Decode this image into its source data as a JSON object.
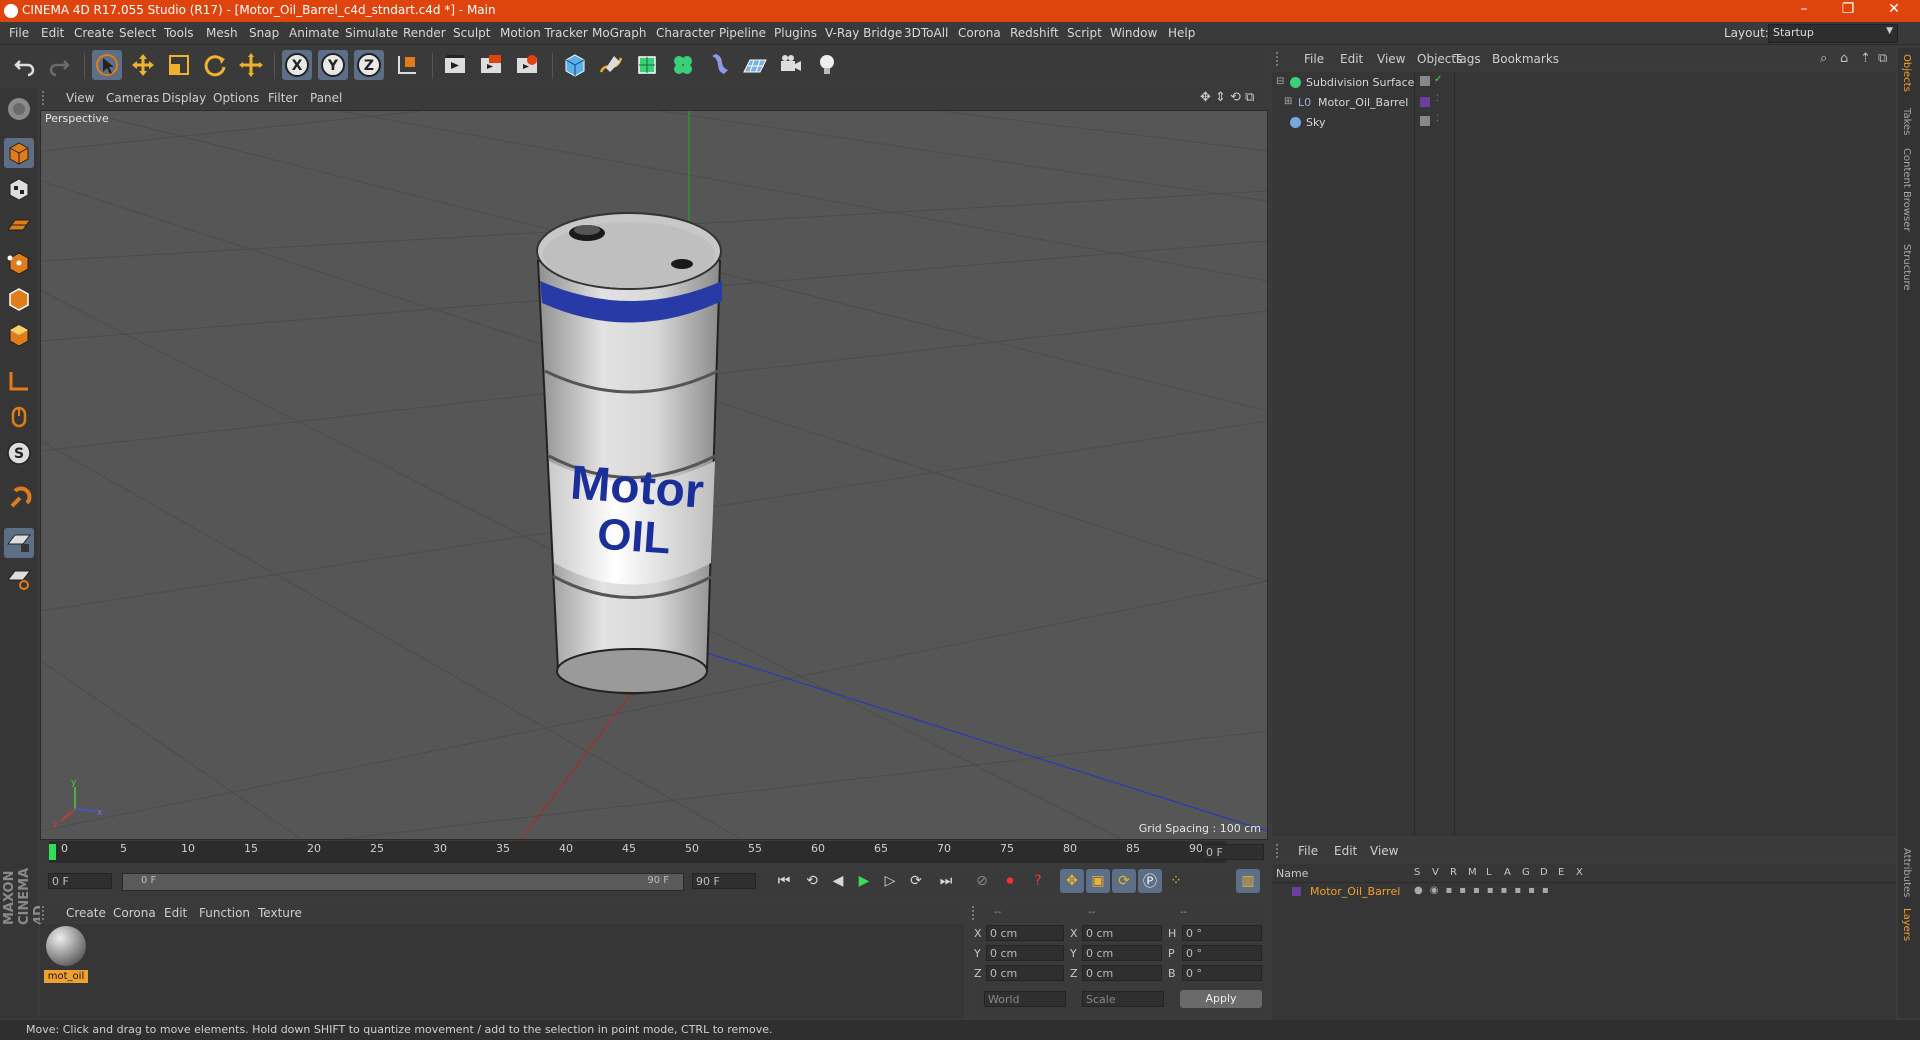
{
  "window": {
    "title": "CINEMA 4D R17.055 Studio (R17) - [Motor_Oil_Barrel_c4d_stndart.c4d *] - Main",
    "controls": [
      "–",
      "❐",
      "✕"
    ]
  },
  "menubar": {
    "items": [
      "File",
      "Edit",
      "Create",
      "Select",
      "Tools",
      "Mesh",
      "Snap",
      "Animate",
      "Simulate",
      "Render",
      "Sculpt",
      "Motion Tracker",
      "MoGraph",
      "Character",
      "Pipeline",
      "Plugins",
      "V-Ray Bridge",
      "3DToAll",
      "Corona",
      "Redshift",
      "Script",
      "Window",
      "Help"
    ],
    "layout_label": "Layout:",
    "layout_value": "Startup"
  },
  "toolbar": {
    "icons": [
      "undo-icon",
      "redo-icon",
      "live-select-icon",
      "move-icon",
      "scale-icon",
      "rotate-icon",
      "recent-tool-icon",
      "x-axis-icon",
      "y-axis-icon",
      "z-axis-icon",
      "coordinate-system-icon",
      "render-view-icon",
      "render-picture-viewer-icon",
      "render-settings-icon",
      "cube-icon",
      "pen-icon",
      "subdivision-icon",
      "cloner-icon",
      "deformer-icon",
      "floor-icon",
      "camera-icon",
      "light-icon"
    ],
    "axis_labels": {
      "x": "X",
      "y": "Y",
      "z": "Z"
    }
  },
  "left_tools": [
    "make-editable-icon",
    "model-mode-icon",
    "texture-mode-icon",
    "workplane-mode-icon",
    "points-mode-icon",
    "edges-mode-icon",
    "polygons-mode-icon",
    "axis-mode-icon",
    "tweak-mode-icon",
    "solo-mode-icon",
    "snap-icon",
    "workplane-lock-icon",
    "grid-icon"
  ],
  "maxon_logo": "MAXON CINEMA 4D",
  "viewport": {
    "menu": [
      "View",
      "Cameras",
      "Display",
      "Options",
      "Filter",
      "Panel"
    ],
    "label": "Perspective",
    "grid_spacing": "Grid Spacing : 100 cm",
    "barrel_text_line1": "Motor",
    "barrel_text_line2": "OIL",
    "axis_labels": {
      "y": "y",
      "x": "x",
      "z": "z"
    }
  },
  "timeline": {
    "ticks": [
      "0",
      "5",
      "10",
      "15",
      "20",
      "25",
      "30",
      "35",
      "40",
      "45",
      "50",
      "55",
      "60",
      "65",
      "70",
      "75",
      "80",
      "85",
      "90"
    ],
    "current_frame": "0 F",
    "start_field": "0 F",
    "range_start": "0 F",
    "range_end": "90 F",
    "end_field": "90 F"
  },
  "material_manager": {
    "menu": [
      "Create",
      "Corona",
      "Edit",
      "Function",
      "Texture"
    ],
    "material_name": "mot_oil"
  },
  "coordinates": {
    "headers": [
      "--",
      "--",
      "--"
    ],
    "rows": [
      {
        "a": "X",
        "a_val": "0 cm",
        "b": "X",
        "b_val": "0 cm",
        "c": "H",
        "c_val": "0 °"
      },
      {
        "a": "Y",
        "a_val": "0 cm",
        "b": "Y",
        "b_val": "0 cm",
        "c": "P",
        "c_val": "0 °"
      },
      {
        "a": "Z",
        "a_val": "0 cm",
        "b": "Z",
        "b_val": "0 cm",
        "c": "B",
        "c_val": "0 °"
      }
    ],
    "world": "World",
    "scale": "Scale",
    "apply": "Apply"
  },
  "object_manager": {
    "menu": [
      "File",
      "Edit",
      "View",
      "Objects",
      "Tags",
      "Bookmarks"
    ],
    "objects": [
      {
        "name": "Subdivision Surface",
        "icon": "subdivision-icon"
      },
      {
        "name": "Motor_Oil_Barrel",
        "icon": "null-object-icon"
      },
      {
        "name": "Sky",
        "icon": "sky-icon"
      }
    ]
  },
  "layer_manager": {
    "menu": [
      "File",
      "Edit",
      "View"
    ],
    "columns": [
      "Name",
      "S",
      "V",
      "R",
      "M",
      "L",
      "A",
      "G",
      "D",
      "E",
      "X"
    ],
    "layers": [
      {
        "name": "Motor_Oil_Barrel",
        "color": "#6a3fa0"
      }
    ]
  },
  "side_tabs": [
    "Objects",
    "Takes",
    "Content Browser",
    "Structure"
  ],
  "side_tabs_bottom": [
    "Attributes",
    "Layers"
  ],
  "status": "Move: Click and drag to move elements. Hold down SHIFT to quantize movement / add to the selection in point mode, CTRL to remove.",
  "colors": {
    "accent": "#e0440e",
    "active": "#5c6f86",
    "text_blue": "#1b2f9a",
    "layer_name": "#f0a030"
  }
}
